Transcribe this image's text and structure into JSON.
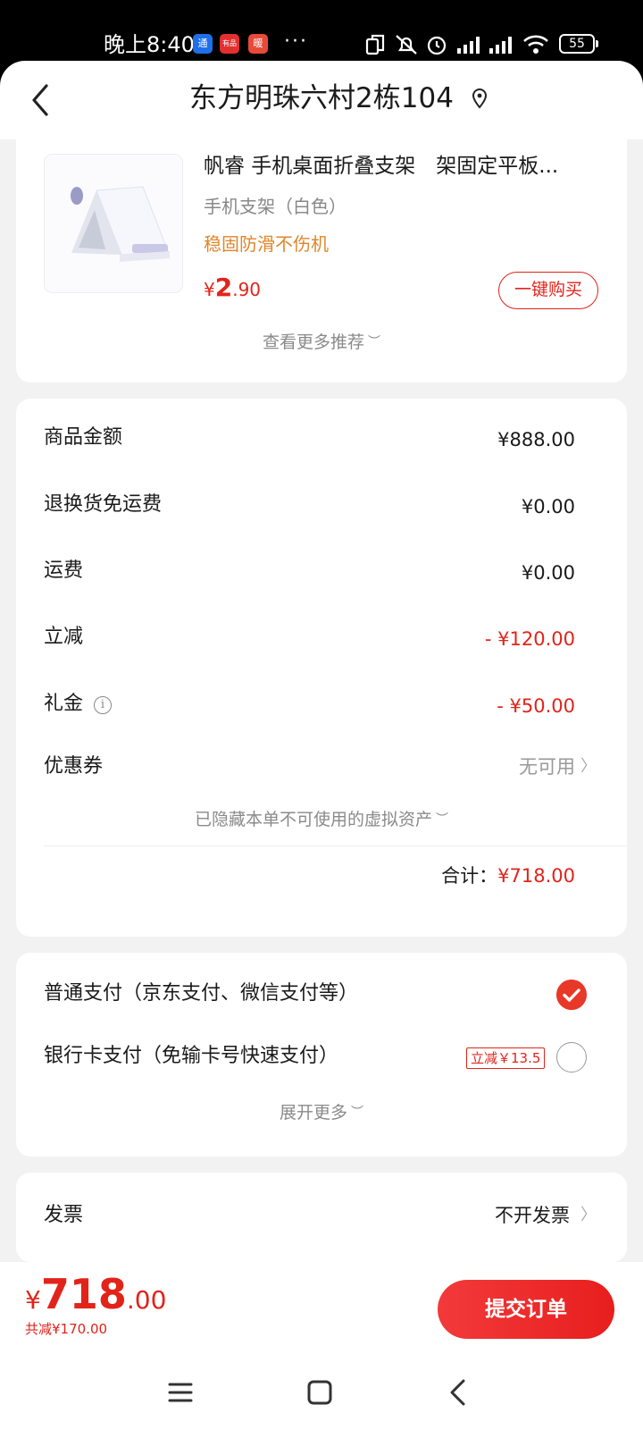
{
  "status_bar": {
    "time": "晚上8:40",
    "app_badges": [
      "通",
      "有品",
      "暖"
    ],
    "dots": "···",
    "battery": "55"
  },
  "header": {
    "title": "东方明珠六村2栋104"
  },
  "product": {
    "title": "帆睿 手机桌面折叠支架　架固定平板...",
    "spec": "手机支架（白色）",
    "tag": "稳固防滑不伤机",
    "price_symbol": "¥",
    "price_int": "2",
    "price_dec": ".90",
    "buy_label": "一键购买",
    "more_label": "查看更多推荐"
  },
  "summary": {
    "rows": [
      {
        "label": "商品金额",
        "value": "¥888.00"
      },
      {
        "label": "退换货免运费",
        "value": "¥0.00"
      },
      {
        "label": "运费",
        "value": "¥0.00"
      },
      {
        "label": "立减",
        "value": "- ¥120.00"
      },
      {
        "label": "礼金",
        "value": "- ¥50.00"
      },
      {
        "label": "优惠券",
        "value": "无可用"
      }
    ],
    "info_icon_glyph": "i",
    "hidden_assets": "已隐藏本单不可使用的虚拟资产",
    "total_label": "合计：",
    "total_value": "¥718.00"
  },
  "payment": {
    "option1": "普通支付（京东支付、微信支付等）",
    "option2": "银行卡支付（免输卡号快速支付）",
    "option2_tag": "立减￥13.5",
    "expand_label": "展开更多"
  },
  "invoice": {
    "label": "发票",
    "value": "不开发票"
  },
  "bottom": {
    "price_symbol": "¥",
    "price_int": "718",
    "price_dec": ".00",
    "discount_text": "共减¥170.00",
    "submit_label": "提交订单"
  },
  "colors": {
    "accent_red": "#e2231a",
    "tag_orange": "#e0862a"
  }
}
